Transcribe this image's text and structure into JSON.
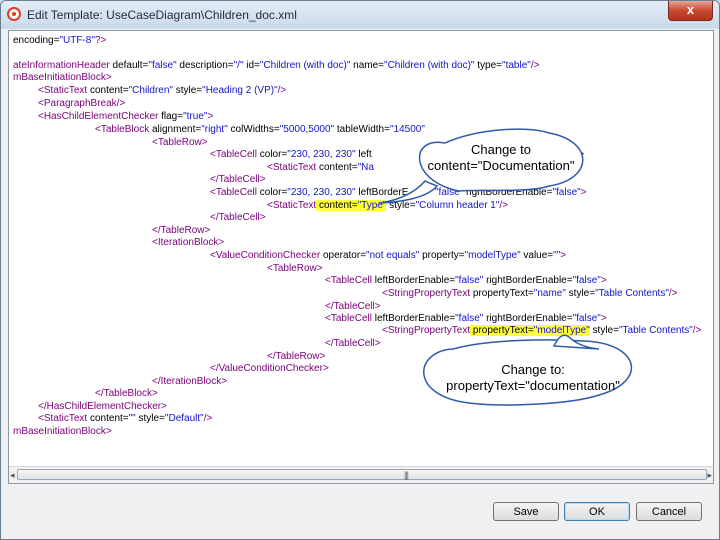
{
  "window": {
    "title": "Edit Template: UseCaseDiagram\\Children_doc.xml",
    "close_symbol": "x"
  },
  "code": {
    "l1": {
      "a": "encoding=",
      "b": "\"UTF-8\"",
      "c": "?>"
    },
    "l2": {
      "a": "ateInformationHeader",
      "b": " default=",
      "c": "\"false\"",
      "d": " description=",
      "e": "\"/\"",
      "f": " id=",
      "g": "\"Children (with doc)\"",
      "h": " name=",
      "i": "\"Children (with doc)\"",
      "j": " type=",
      "k": "\"table\"",
      "l": "/>"
    },
    "l3": {
      "a": "mBaseInitiationBlock",
      "b": ">"
    },
    "l4": {
      "a": "<StaticText",
      "b": " content=",
      "c": "\"Children\"",
      "d": " style=",
      "e": "\"Heading 2 (VP)\"",
      "f": "/>"
    },
    "l5": {
      "a": "<ParagraphBreak",
      "b": "/>"
    },
    "l6": {
      "a": "<HasChildElementChecker",
      "b": " flag=",
      "c": "\"true\"",
      "d": ">"
    },
    "l7": {
      "a": "<TableBlock",
      "b": " alignment=",
      "c": "\"right\"",
      "d": " colWidths=",
      "e": "\"5000,5000\"",
      "f": " tableWidth=",
      "g": "\"14500\""
    },
    "l8": {
      "a": "<TableRow>"
    },
    "l9": {
      "a": "<TableCell",
      "b": " color=",
      "c": "\"230, 230, 230\"",
      "d": " left",
      "e": "\">"
    },
    "l10": {
      "a": "<StaticText",
      "b": " content=",
      "c": "\"Na"
    },
    "l11": {
      "a": "</TableCell>"
    },
    "l12": {
      "a": "<TableCell",
      "b": " color=",
      "c": "\"230, 230, 230\"",
      "d": " leftBorderE",
      "e": "\"false\"",
      "f": " rightBorderEnable=",
      "g": "\"false\"",
      "h": ">"
    },
    "l13": {
      "a": "<StaticText",
      "b": " content=",
      "c": "\"Type\"",
      "d": " style=",
      "e": "\"Column header 1\"",
      "f": "/>"
    },
    "l14": {
      "a": "</TableCell>"
    },
    "l15": {
      "a": "</TableRow>"
    },
    "l16": {
      "a": "<IterationBlock>"
    },
    "l17": {
      "a": "<ValueConditionChecker",
      "b": " operator=",
      "c": "\"not equals\"",
      "d": " property=",
      "e": "\"modelType\"",
      "f": " value=",
      "g": "\"\"",
      "h": ">"
    },
    "l18": {
      "a": "<TableRow>"
    },
    "l19": {
      "a": "<TableCell",
      "b": " leftBorderEnable=",
      "c": "\"false\"",
      "d": " rightBorderEnable=",
      "e": "\"false\"",
      "f": ">"
    },
    "l20": {
      "a": "<StringPropertyText",
      "b": " propertyText=",
      "c": "\"name\"",
      "d": " style=",
      "e": "\"Table Contents\"",
      "f": "/>"
    },
    "l21": {
      "a": "</TableCell>"
    },
    "l22": {
      "a": "<TableCell",
      "b": " leftBorderEnable=",
      "c": "\"false\"",
      "d": " rightBorderEnable=",
      "e": "\"false\"",
      "f": ">"
    },
    "l23": {
      "a": "<StringPropertyText",
      "b": " propertyText=",
      "c": "\"modelType\"",
      "d": " style=",
      "e": "\"Table Contents\"",
      "f": "/>"
    },
    "l24": {
      "a": "</TableCell>"
    },
    "l25": {
      "a": "</TableRow>"
    },
    "l26": {
      "a": "</ValueConditionChecker>"
    },
    "l27": {
      "a": "</IterationBlock>"
    },
    "l28": {
      "a": "</TableBlock>"
    },
    "l29": {
      "a": "</HasChildElementChecker>"
    },
    "l30": {
      "a": "<StaticText",
      "b": " content=",
      "c": "\"\"",
      "d": " style=",
      "e": "\"Default\"",
      "f": "/>"
    },
    "l31": {
      "a": "mBaseInitiationBlock",
      "b": ">"
    }
  },
  "callouts": {
    "top": {
      "line1": "Change to",
      "line2": "content=\"Documentation\""
    },
    "bottom": {
      "line1": "Change to:",
      "line2": "propertyText=\"documentation\""
    }
  },
  "scrollbar": {
    "left_arrow": "◂",
    "right_arrow": "▸",
    "grip": "|||"
  },
  "buttons": {
    "save": "Save",
    "ok": "OK",
    "cancel": "Cancel"
  },
  "colors": {
    "tag": "#7a007a",
    "attr_value": "#1414cc",
    "highlight": "#ffff40",
    "callout_border": "#2f5ba8"
  }
}
